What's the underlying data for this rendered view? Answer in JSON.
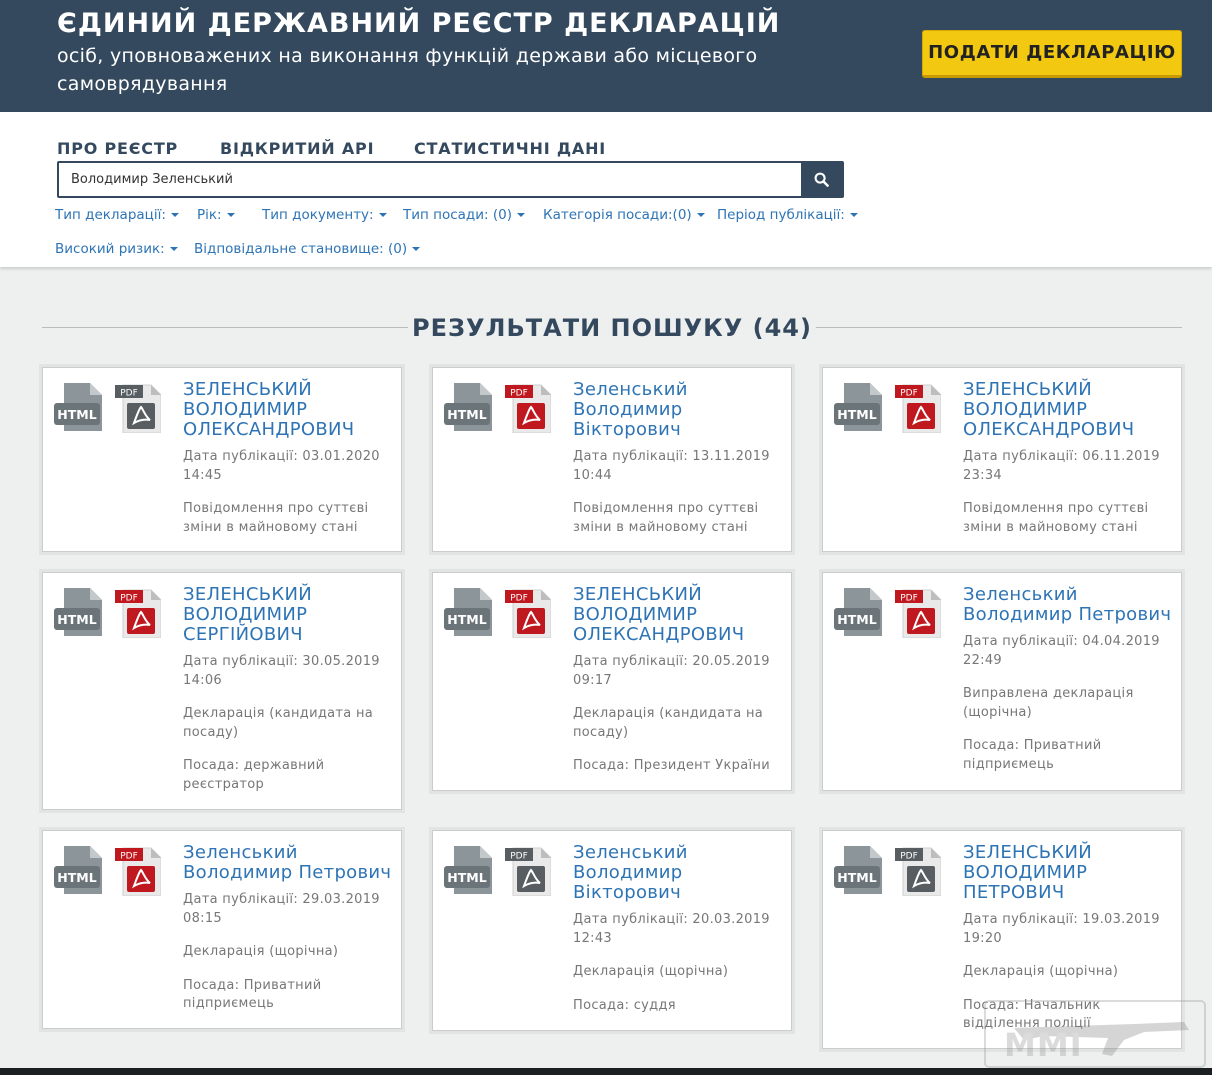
{
  "header": {
    "title": "ЄДИНИЙ ДЕРЖАВНИЙ РЕЄСТР ДЕКЛАРАЦІЙ",
    "subtitle": "осіб, уповноважених на виконання функцій держави або місцевого самоврядування",
    "submit_label": "ПОДАТИ ДЕКЛАРАЦІЮ"
  },
  "nav": [
    "ПРО РЕЄСТР",
    "ВІДКРИТИЙ API",
    "СТАТИСТИЧНІ ДАНІ"
  ],
  "search": {
    "value": "Володимир Зеленський"
  },
  "filters": [
    "Тип декларації:",
    "Рік:",
    "Тип документу:",
    "Тип посади: (0)",
    "Категорія посади:(0)",
    "Період публікації:",
    "Високий ризик:",
    "Відповідальне становище: (0)"
  ],
  "results_title": "РЕЗУЛЬТАТИ ПОШУКУ (44)",
  "icons": {
    "html_label": "HTML",
    "pdf_label": "PDF"
  },
  "colors": {
    "header_bg": "#34495e",
    "accent_yellow": "#f2c811",
    "link_blue": "#2e74b5",
    "pdf_red": "#c0181f"
  },
  "cards": [
    {
      "name": "ЗЕЛЕНСЬКИЙ ВОЛОДИМИР ОЛЕКСАНДРОВИЧ",
      "date": "Дата публікації: 03.01.2020 14:45",
      "type": "Повідомлення про суттєві зміни в майновому стані",
      "position": "",
      "pdf_color": "gray"
    },
    {
      "name": "Зеленський Володимир Вікторович",
      "date": "Дата публікації: 13.11.2019 10:44",
      "type": "Повідомлення про суттєві зміни в майновому стані",
      "position": "",
      "pdf_color": "red"
    },
    {
      "name": "ЗЕЛЕНСЬКИЙ ВОЛОДИМИР ОЛЕКСАНДРОВИЧ",
      "date": "Дата публікації: 06.11.2019 23:34",
      "type": "Повідомлення про суттєві зміни в майновому стані",
      "position": "",
      "pdf_color": "red"
    },
    {
      "name": "ЗЕЛЕНСЬКИЙ ВОЛОДИМИР СЕРГІЙОВИЧ",
      "date": "Дата публікації: 30.05.2019 14:06",
      "type": "Декларація (кандидата на посаду)",
      "position": "Посада: державний реєстратор",
      "pdf_color": "red"
    },
    {
      "name": "ЗЕЛЕНСЬКИЙ ВОЛОДИМИР ОЛЕКСАНДРОВИЧ",
      "date": "Дата публікації: 20.05.2019 09:17",
      "type": "Декларація (кандидата на посаду)",
      "position": "Посада: Президент України",
      "pdf_color": "red"
    },
    {
      "name": "Зеленський Володимир Петрович",
      "date": "Дата публікації: 04.04.2019 22:49",
      "type": "Виправлена декларація (щорічна)",
      "position": "Посада: Приватний підприємець",
      "pdf_color": "red"
    },
    {
      "name": "Зеленський Володимир Петрович",
      "date": "Дата публікації: 29.03.2019 08:15",
      "type": "Декларація (щорічна)",
      "position": "Посада: Приватний підприємець",
      "pdf_color": "red"
    },
    {
      "name": "Зеленський Володимир Вікторович",
      "date": "Дата публікації: 20.03.2019 12:43",
      "type": "Декларація (щорічна)",
      "position": "Посада: суддя",
      "pdf_color": "gray"
    },
    {
      "name": "ЗЕЛЕНСЬКИЙ ВОЛОДИМИР ПЕТРОВИЧ",
      "date": "Дата публікації: 19.03.2019 19:20",
      "type": "Декларація (щорічна)",
      "position": "Посада: Начальник відділення поліції",
      "pdf_color": "gray"
    }
  ],
  "watermark": "MMI"
}
